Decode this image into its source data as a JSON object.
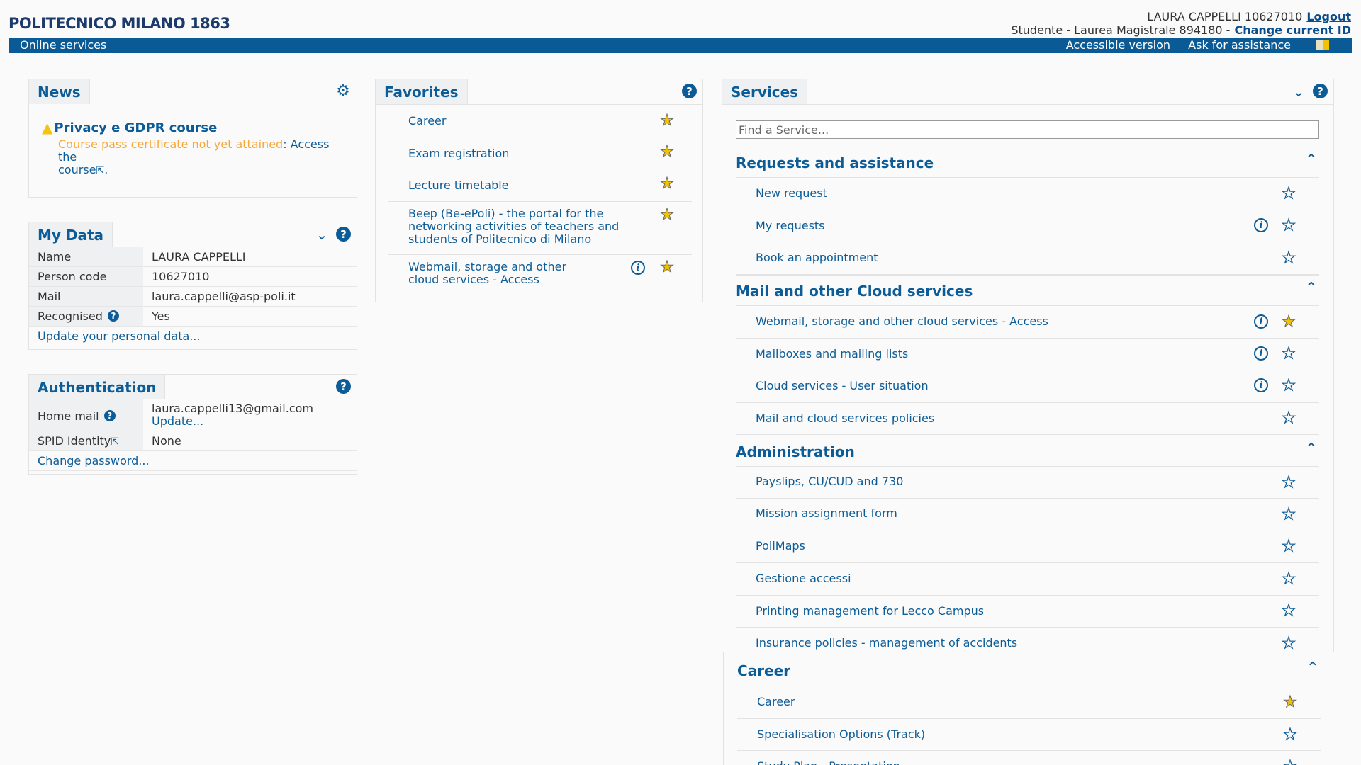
{
  "header": {
    "brand": "POLITECNICO MILANO 1863",
    "user_info": "LAURA CAPPELLI 10627010",
    "logout": "Logout",
    "role_info": "Studente - Laurea Magistrale 894180 -",
    "change_id": "Change current ID",
    "online_services": "Online services",
    "accessible_version": "Accessible version",
    "ask_assistance": "Ask for assistance"
  },
  "news": {
    "tab": "News",
    "item_title": "Privacy e GDPR course",
    "status": "Course pass certificate not yet attained",
    "text_a": ": Access the",
    "text_b": "course",
    "text_c": "."
  },
  "mydata": {
    "tab": "My Data",
    "rows": [
      {
        "k": "Name",
        "v": "LAURA CAPPELLI"
      },
      {
        "k": "Person code",
        "v": "10627010"
      },
      {
        "k": "Mail",
        "v": "laura.cappelli@asp-poli.it"
      },
      {
        "k": "Recognised",
        "v": "Yes"
      }
    ],
    "update": "Update your personal data..."
  },
  "auth": {
    "tab": "Authentication",
    "home_mail_label": "Home mail",
    "home_mail_value": "laura.cappelli13@gmail.com",
    "update": "Update...",
    "spid_label": "SPID Identity",
    "spid_value": "None",
    "change_password": "Change password..."
  },
  "favorites": {
    "tab": "Favorites",
    "items": [
      {
        "label": "Career",
        "starred": true
      },
      {
        "label": "Exam registration",
        "starred": true
      },
      {
        "label": "Lecture timetable",
        "starred": true
      },
      {
        "label": "Beep (Be-ePoli) - the portal for the networking activities of teachers and students of Politecnico di Milano",
        "starred": true
      },
      {
        "label": "Webmail, storage and other cloud services - Access",
        "starred": true
      }
    ]
  },
  "services": {
    "tab": "Services",
    "search_placeholder": "Find a Service...",
    "groups": [
      {
        "title": "Requests and assistance",
        "items": [
          {
            "label": "New request",
            "starred": false
          },
          {
            "label": "My requests",
            "starred": false
          },
          {
            "label": "Book an appointment",
            "starred": false
          }
        ]
      },
      {
        "title": "Mail and other Cloud services",
        "items": [
          {
            "label": "Webmail, storage and other cloud services - Access",
            "starred": true
          },
          {
            "label": "Mailboxes and mailing lists",
            "starred": false
          },
          {
            "label": "Cloud services - User situation",
            "starred": false
          },
          {
            "label": "Mail and cloud services policies",
            "starred": false
          }
        ]
      },
      {
        "title": "Administration",
        "items": [
          {
            "label": "Payslips, CU/CUD and 730",
            "starred": false
          },
          {
            "label": "Mission assignment form",
            "starred": false
          },
          {
            "label": "PoliMaps",
            "starred": false
          },
          {
            "label": "Gestione accessi",
            "starred": false
          },
          {
            "label": "Printing management for Lecco Campus",
            "starred": false
          },
          {
            "label": "Insurance policies - management of accidents",
            "starred": false
          }
        ]
      },
      {
        "title": "Career",
        "items": [
          {
            "label": "Career",
            "starred": true
          },
          {
            "label": "Specialisation Options (Track)",
            "starred": false
          },
          {
            "label": "Study Plan - Presentation",
            "starred": false
          }
        ]
      }
    ]
  },
  "icons": {
    "star": "★",
    "info": "i",
    "help": "?",
    "chevron_down": "⌄",
    "chevron_up": "⌃",
    "gear": "⚙",
    "warning": "⚠",
    "external": "⇱"
  }
}
